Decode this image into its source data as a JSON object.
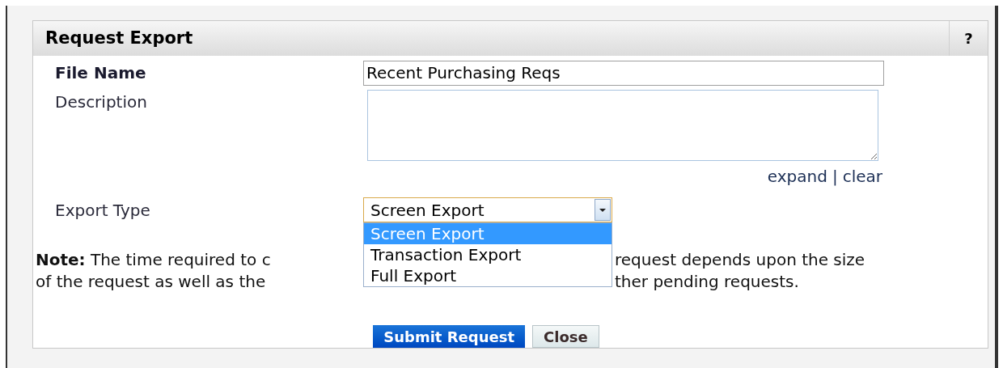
{
  "dialog": {
    "title": "Request Export",
    "help": "?"
  },
  "fields": [
    {
      "kind": "text",
      "label": "File Name",
      "value": "Recent Purchasing Reqs"
    },
    {
      "kind": "textarea",
      "label": "Description"
    }
  ],
  "links": [
    "expand",
    "|",
    "clear"
  ],
  "export_type": {
    "label": "Export Type",
    "value": "Screen Export",
    "options": [
      {
        "label": "Screen Export",
        "selected": true
      },
      {
        "label": "Transaction Export",
        "selected": false
      },
      {
        "label": "Full Export",
        "selected": false
      }
    ]
  },
  "note_lines": [
    {
      "left": "**Note:** The time required to c",
      "right": "request depends upon the size"
    },
    {
      "left": "of the request as well as the",
      "right": "ther pending requests."
    }
  ],
  "buttons": [
    {
      "kind": "primary",
      "label": "Submit Request"
    },
    {
      "kind": "secondary",
      "label": "Close"
    }
  ]
}
